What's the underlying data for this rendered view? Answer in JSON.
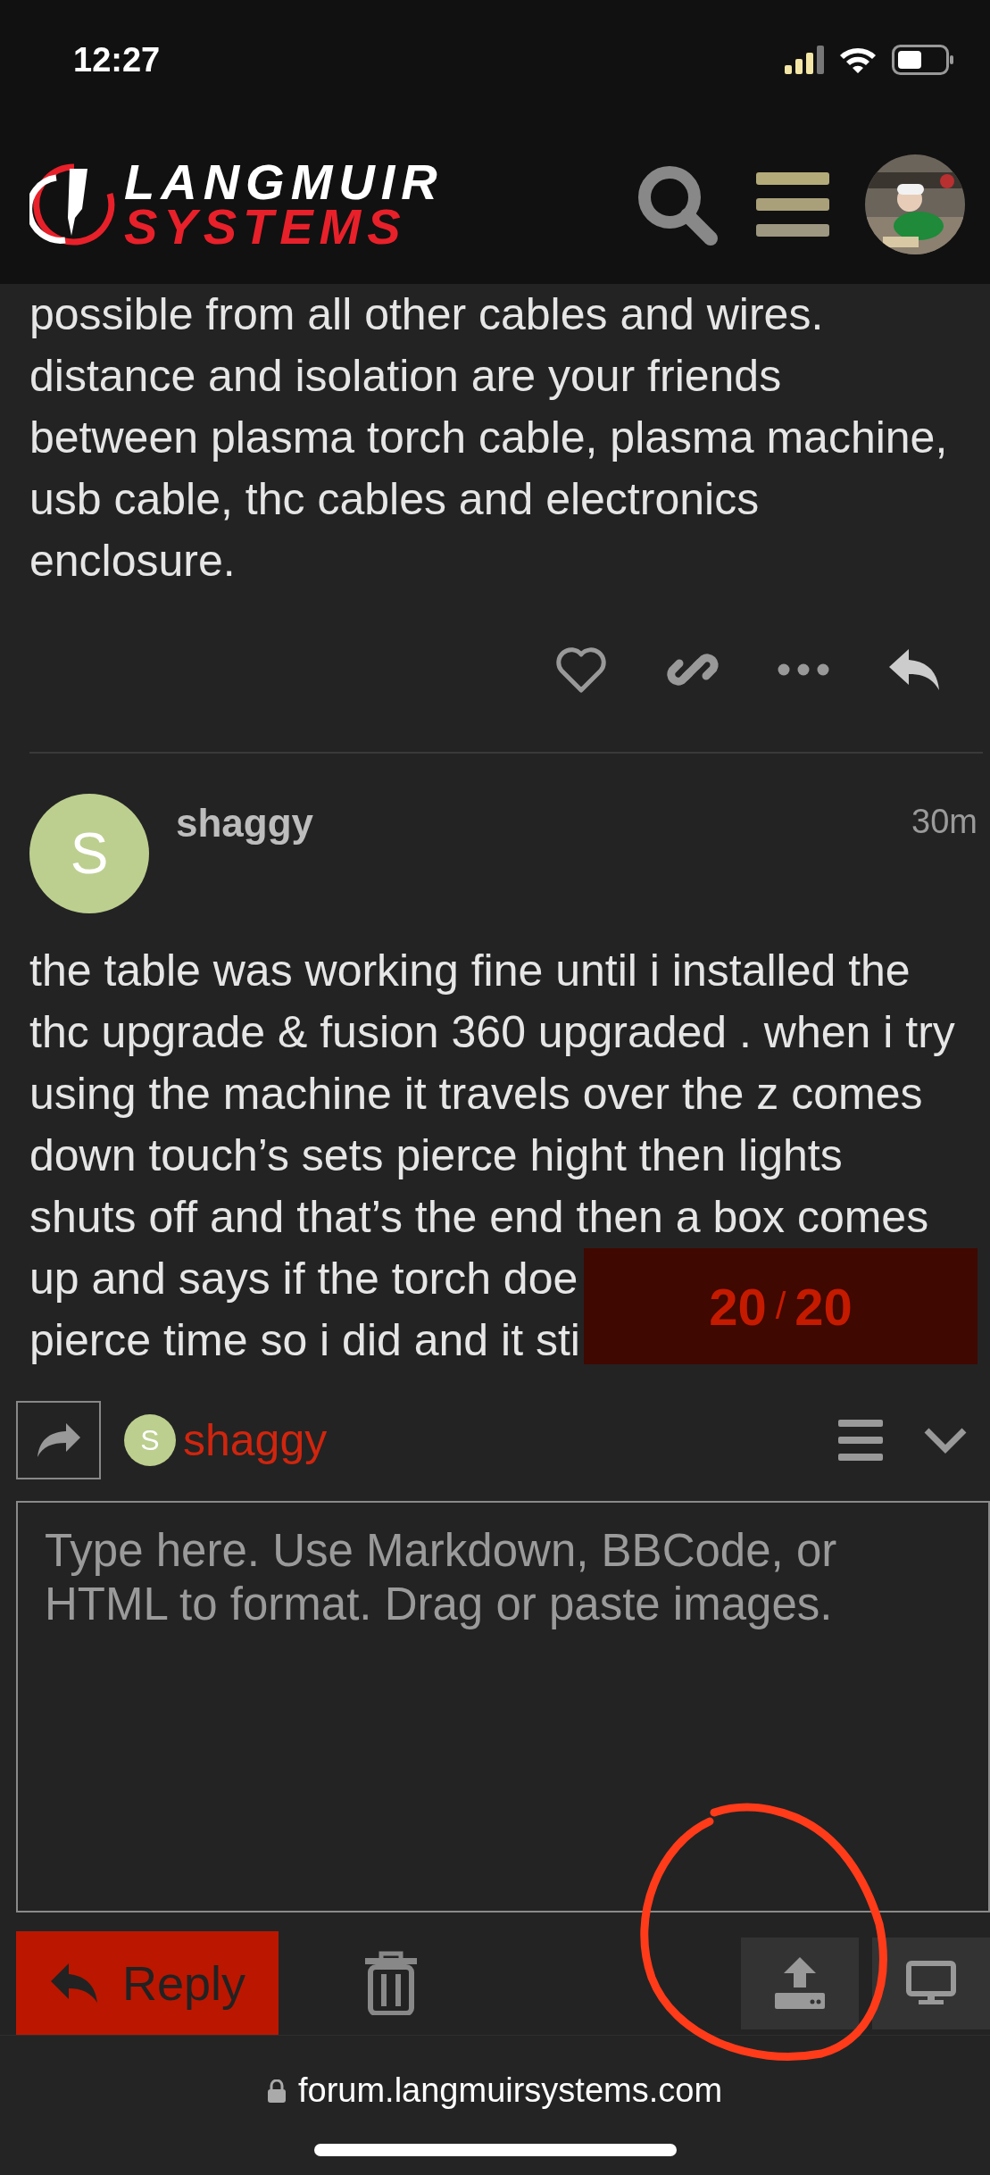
{
  "status_bar": {
    "time": "12:27"
  },
  "header": {
    "logo_top": "LANGMUIR",
    "logo_bottom": "SYSTEMS"
  },
  "previous_post": {
    "lines": [
      "possible from all other cables and wires.",
      "distance and isolation are your friends",
      "between plasma torch cable, plasma machine,",
      "usb cable, thc cables and electronics",
      "enclosure."
    ]
  },
  "post": {
    "author": "shaggy",
    "avatar_letter": "S",
    "time": "30m",
    "lines": [
      "the table was working fine until i installed the",
      "thc upgrade & fusion 360 upgraded . when i try",
      "using the machine it travels over the z comes",
      "down touch’s sets pierce hight then lights",
      "shuts off and that’s the end then a box comes"
    ],
    "covered_lines": [
      "up and says if the torch doe",
      "pierce time so i did and it sti"
    ]
  },
  "progress": {
    "current": "20",
    "separator": "/",
    "total": "20"
  },
  "composer": {
    "reply_to": {
      "avatar_letter": "S",
      "username": "shaggy"
    },
    "placeholder": "Type here. Use Markdown, BBCode, or HTML to format. Drag or paste images.",
    "reply_button": "Reply"
  },
  "browser": {
    "url": "forum.langmuirsystems.com"
  }
}
